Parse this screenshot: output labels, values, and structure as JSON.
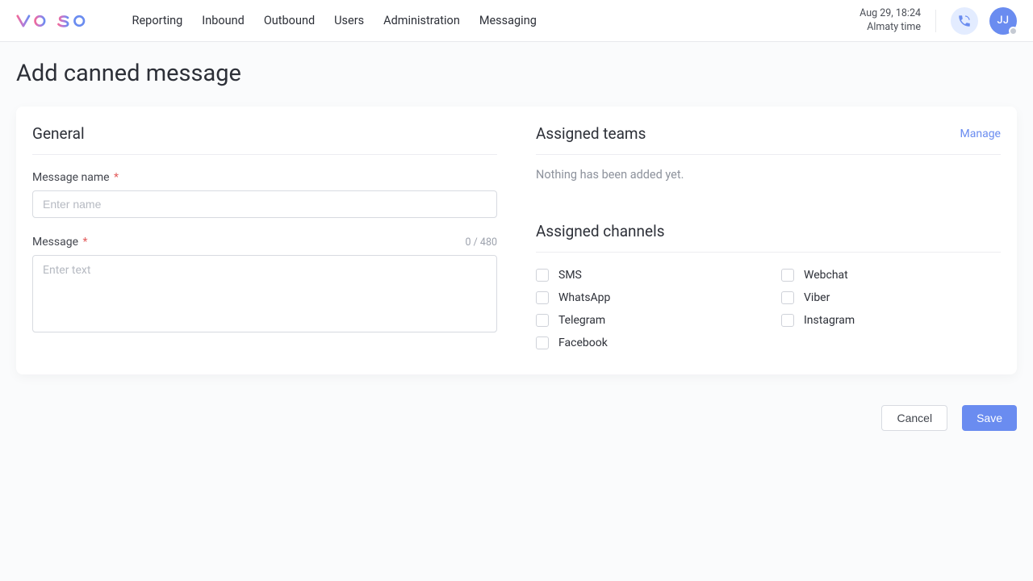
{
  "header": {
    "nav": [
      "Reporting",
      "Inbound",
      "Outbound",
      "Users",
      "Administration",
      "Messaging"
    ],
    "datetime_line1": "Aug 29, 18:24",
    "datetime_line2": "Almaty time",
    "avatar_initials": "JJ"
  },
  "page": {
    "title": "Add canned message"
  },
  "general": {
    "section_title": "General",
    "name_label": "Message name",
    "name_placeholder": "Enter name",
    "name_value": "",
    "message_label": "Message",
    "message_placeholder": "Enter text",
    "message_value": "",
    "char_counter": "0 / 480"
  },
  "teams": {
    "section_title": "Assigned teams",
    "manage_label": "Manage",
    "empty_text": "Nothing has been added yet."
  },
  "channels": {
    "section_title": "Assigned channels",
    "left": [
      "SMS",
      "WhatsApp",
      "Telegram",
      "Facebook"
    ],
    "right": [
      "Webchat",
      "Viber",
      "Instagram"
    ]
  },
  "footer": {
    "cancel": "Cancel",
    "save": "Save"
  }
}
